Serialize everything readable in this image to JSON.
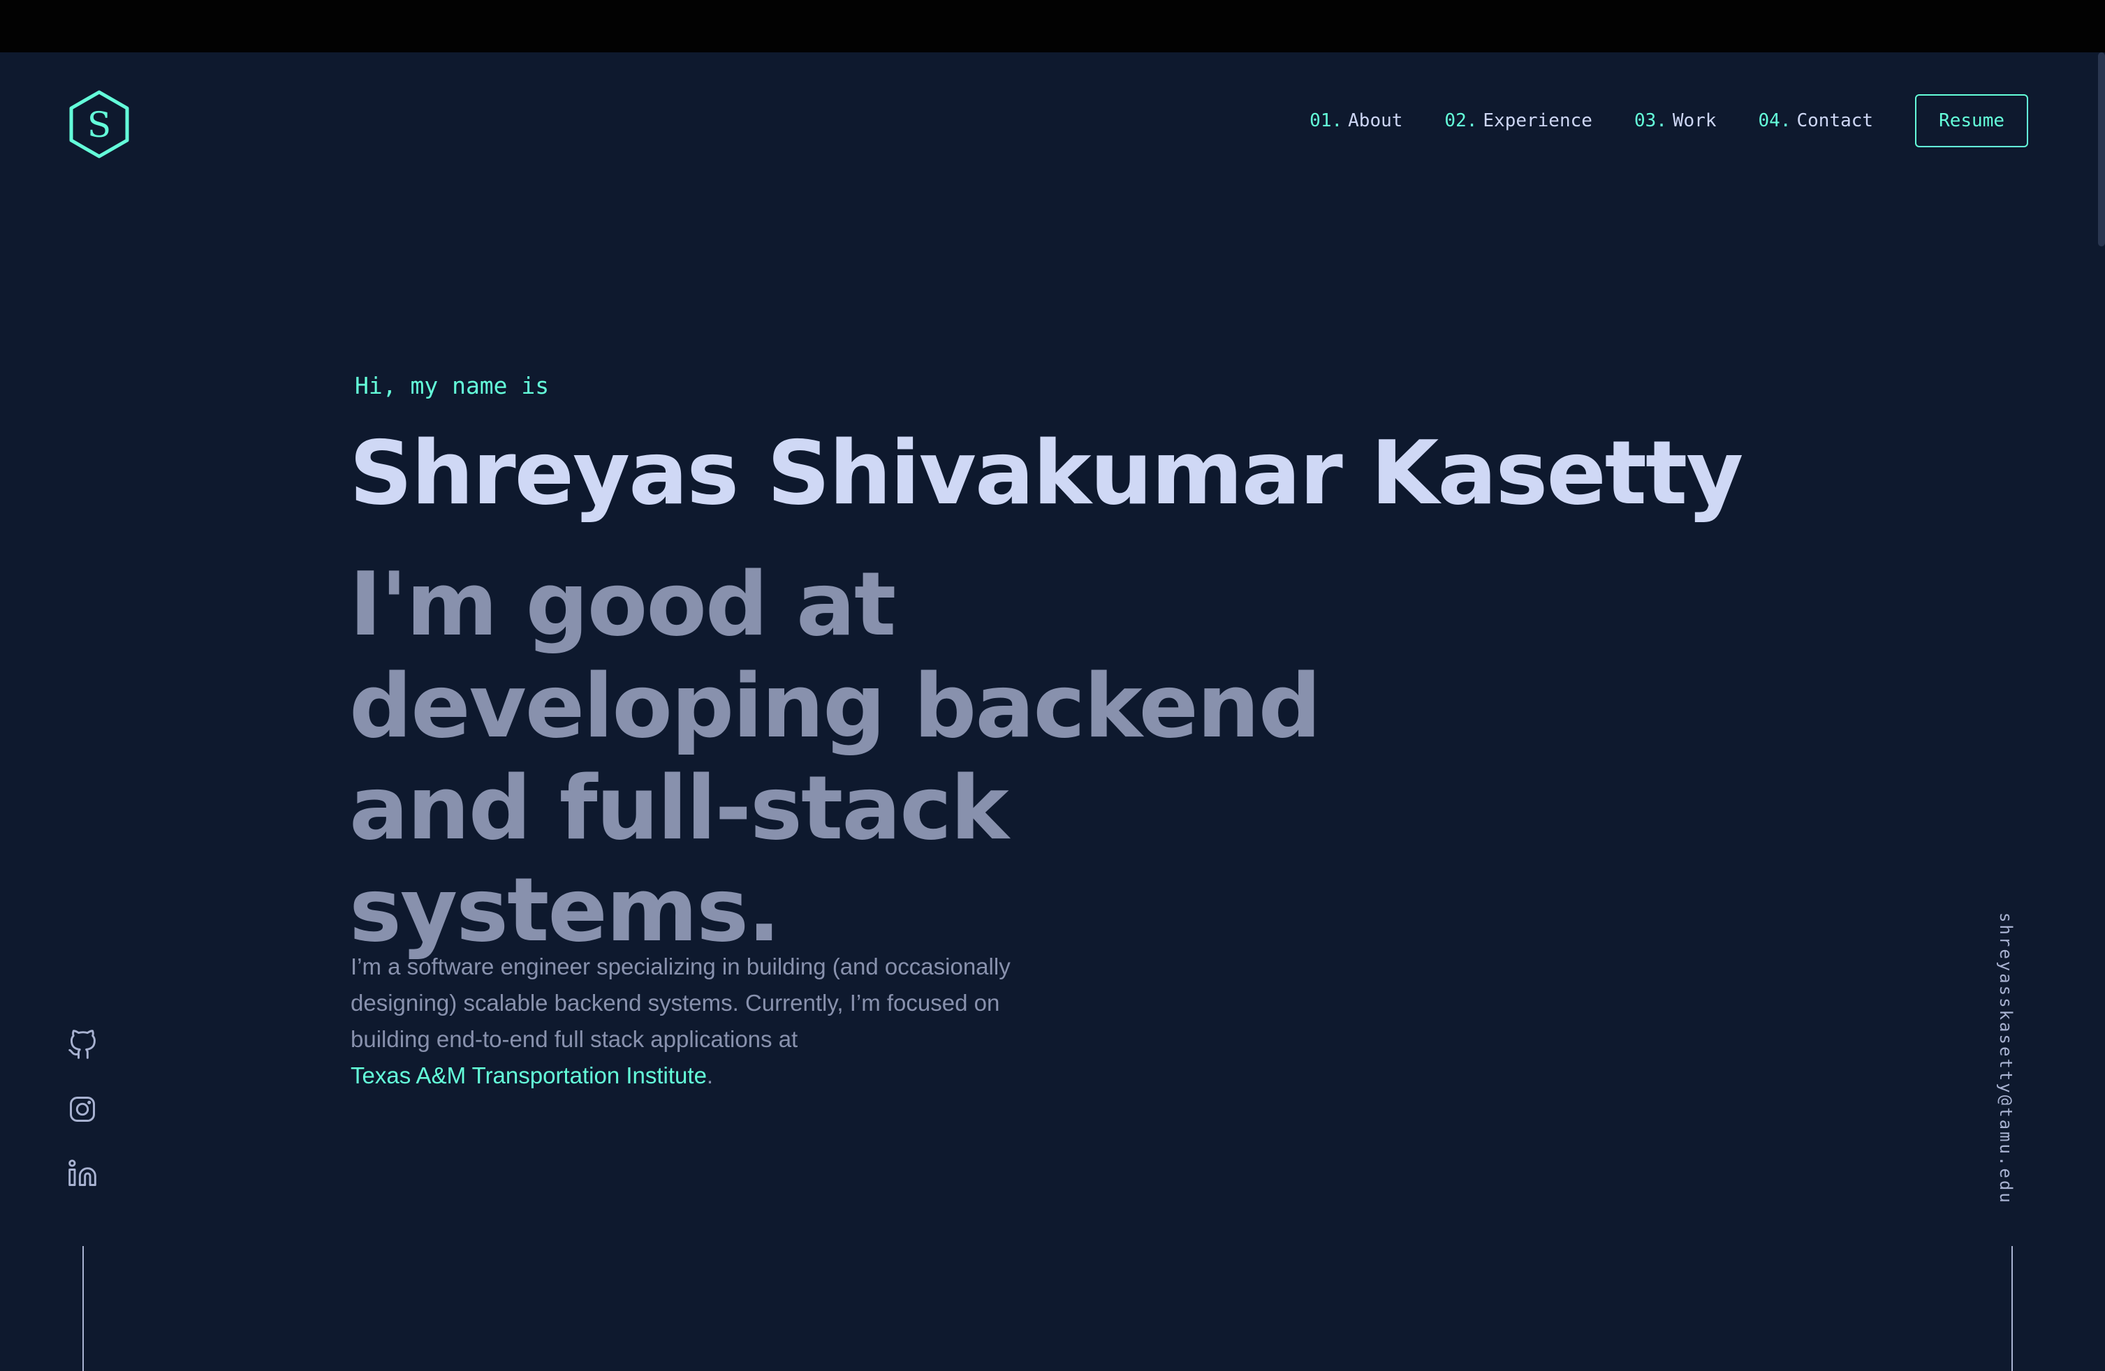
{
  "header": {
    "logo_letter": "S",
    "nav": [
      {
        "num": "01.",
        "label": "About"
      },
      {
        "num": "02.",
        "label": "Experience"
      },
      {
        "num": "03.",
        "label": "Work"
      },
      {
        "num": "04.",
        "label": "Contact"
      }
    ],
    "resume_label": "Resume"
  },
  "hero": {
    "greeting": "Hi, my name is",
    "name": "Shreyas Shivakumar Kasetty",
    "tagline": "I'm good at developing backend and full-stack systems.",
    "bio_text": "I’m a software engineer specializing in building (and occasionally designing) scalable backend systems. Currently, I’m focused on building end-to-end full stack applications at",
    "bio_link": "Texas A&M Transportation Institute",
    "bio_end": "."
  },
  "social": [
    {
      "icon": "github-icon"
    },
    {
      "icon": "instagram-icon"
    },
    {
      "icon": "linkedin-icon"
    }
  ],
  "email": "shreyasskasetty@tamu.edu",
  "colors": {
    "background": "#0e192e",
    "accent": "#64ffda",
    "heading": "#cfd8f5",
    "muted": "#8891ad"
  }
}
